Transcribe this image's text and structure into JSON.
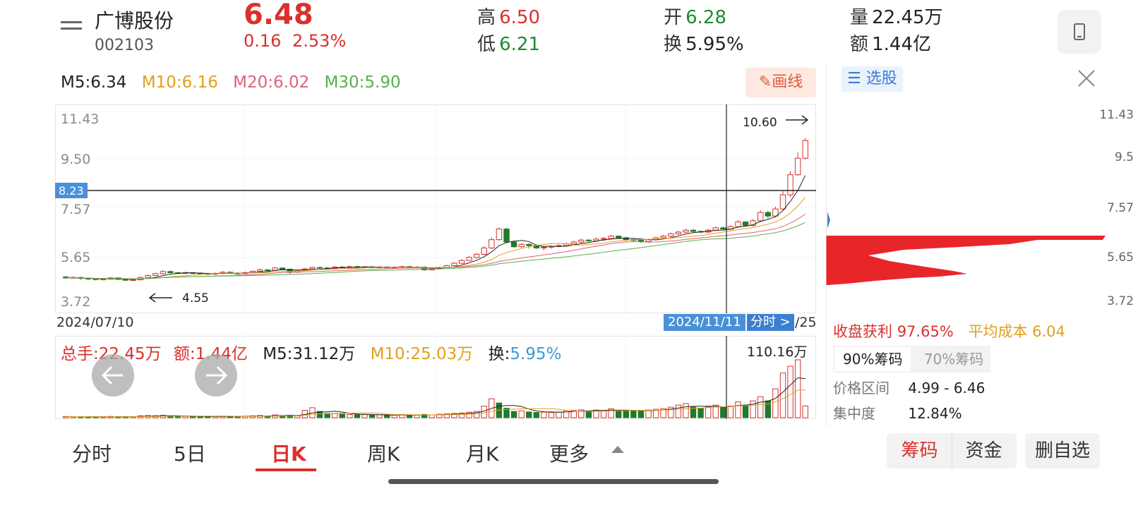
{
  "header": {
    "stock_name": "广博股份",
    "stock_code": "002103",
    "price": "6.48",
    "change": "0.16",
    "change_pct": "2.53%",
    "high_label": "高",
    "high": "6.50",
    "low_label": "低",
    "low": "6.21",
    "open_label": "开",
    "open": "6.28",
    "turnover_label": "换",
    "turnover": "5.95%",
    "volume_label": "量",
    "volume": "22.45万",
    "amount_label": "额",
    "amount": "1.44亿"
  },
  "ma_bar": {
    "m5": "M5:6.34",
    "m10": "M10:6.16",
    "m20": "M20:6.02",
    "m30": "M30:5.90",
    "draw_button": "画线"
  },
  "price_axis": [
    "11.43",
    "9.50",
    "7.57",
    "5.65",
    "3.72"
  ],
  "crosshair_price": "8.23",
  "max_marker": "10.60",
  "min_marker": "4.55",
  "date_start": "2024/07/10",
  "crosshair_date": "2024/11/11",
  "date_end_partial": "/25",
  "fenshi_button": "分时 >",
  "volume_bar": {
    "total": "总手:22.45万",
    "amount": "额:1.44亿",
    "m5": "M5:31.12万",
    "m10": "M10:25.03万",
    "turnover_label": "换:",
    "turnover": "5.95%",
    "max": "110.16万"
  },
  "chip_panel": {
    "select_label": "选股",
    "axis": [
      "11.43",
      "9.5",
      "7.57",
      "5.65",
      "3.72"
    ],
    "profit_label": "收盘获利",
    "profit": "97.65%",
    "avg_cost_label": "平均成本",
    "avg_cost": "6.04",
    "tab_90": "90%筹码",
    "tab_70": "70%筹码",
    "range_label": "价格区间",
    "range": "4.99 - 6.46",
    "concentration_label": "集中度",
    "concentration": "12.84%"
  },
  "bottom_tabs": [
    "分时",
    "5日",
    "日K",
    "周K",
    "月K",
    "更多"
  ],
  "bottom_buttons": [
    "筹码",
    "资金",
    "删自选"
  ],
  "colors": {
    "up": "#d9312c",
    "down": "#1f7a2a",
    "m5": "#222222",
    "m10": "#e0a020",
    "m20": "#e0607a",
    "m30": "#58b04e"
  },
  "chart_data": {
    "type": "candlestick",
    "ylim": [
      3.72,
      11.43
    ],
    "candles": [
      [
        4.72,
        4.68,
        4.76,
        4.63
      ],
      [
        4.68,
        4.7,
        4.75,
        4.64
      ],
      [
        4.7,
        4.66,
        4.73,
        4.6
      ],
      [
        4.66,
        4.64,
        4.7,
        4.59
      ],
      [
        4.64,
        4.61,
        4.68,
        4.57
      ],
      [
        4.61,
        4.63,
        4.67,
        4.58
      ],
      [
        4.63,
        4.68,
        4.72,
        4.6
      ],
      [
        4.68,
        4.62,
        4.7,
        4.58
      ],
      [
        4.62,
        4.58,
        4.65,
        4.55
      ],
      [
        4.58,
        4.6,
        4.64,
        4.55
      ],
      [
        4.6,
        4.7,
        4.74,
        4.58
      ],
      [
        4.7,
        4.78,
        4.82,
        4.68
      ],
      [
        4.78,
        4.86,
        4.9,
        4.75
      ],
      [
        4.86,
        4.95,
        5.0,
        4.83
      ],
      [
        4.95,
        4.9,
        4.99,
        4.86
      ],
      [
        4.9,
        4.87,
        4.94,
        4.84
      ],
      [
        4.87,
        4.9,
        4.95,
        4.84
      ],
      [
        4.9,
        4.88,
        4.93,
        4.85
      ],
      [
        4.88,
        4.86,
        4.92,
        4.82
      ],
      [
        4.86,
        4.84,
        4.9,
        4.8
      ],
      [
        4.84,
        4.87,
        4.92,
        4.8
      ],
      [
        4.87,
        4.92,
        4.97,
        4.84
      ],
      [
        4.92,
        4.88,
        4.96,
        4.85
      ],
      [
        4.88,
        4.86,
        4.92,
        4.82
      ],
      [
        4.86,
        4.9,
        4.95,
        4.84
      ],
      [
        4.9,
        4.96,
        5.0,
        4.87
      ],
      [
        4.96,
        5.02,
        5.08,
        4.93
      ],
      [
        5.02,
        5.0,
        5.06,
        4.97
      ],
      [
        5.0,
        5.1,
        5.14,
        4.98
      ],
      [
        5.1,
        5.05,
        5.12,
        5.0
      ],
      [
        5.05,
        4.92,
        5.07,
        4.85
      ],
      [
        4.92,
        5.0,
        5.04,
        4.9
      ],
      [
        5.0,
        5.06,
        5.1,
        4.97
      ],
      [
        5.06,
        5.12,
        5.16,
        5.03
      ],
      [
        5.12,
        5.1,
        5.16,
        5.06
      ],
      [
        5.1,
        5.08,
        5.14,
        5.04
      ],
      [
        5.08,
        5.14,
        5.18,
        5.05
      ],
      [
        5.14,
        5.12,
        5.18,
        5.08
      ],
      [
        5.12,
        5.16,
        5.2,
        5.09
      ],
      [
        5.16,
        5.13,
        5.2,
        5.09
      ],
      [
        5.13,
        5.15,
        5.19,
        5.1
      ],
      [
        5.15,
        5.12,
        5.18,
        5.08
      ],
      [
        5.12,
        5.14,
        5.18,
        5.09
      ],
      [
        5.14,
        5.11,
        5.17,
        5.07
      ],
      [
        5.11,
        5.13,
        5.17,
        5.08
      ],
      [
        5.13,
        5.16,
        5.2,
        5.1
      ],
      [
        5.16,
        5.12,
        5.19,
        5.08
      ],
      [
        5.12,
        5.14,
        5.18,
        5.09
      ],
      [
        5.14,
        5.02,
        5.16,
        4.98
      ],
      [
        5.02,
        5.08,
        5.12,
        5.0
      ],
      [
        5.08,
        5.12,
        5.16,
        5.05
      ],
      [
        5.12,
        5.2,
        5.24,
        5.1
      ],
      [
        5.2,
        5.3,
        5.35,
        5.17
      ],
      [
        5.3,
        5.42,
        5.48,
        5.28
      ],
      [
        5.42,
        5.55,
        5.6,
        5.4
      ],
      [
        5.55,
        5.68,
        5.74,
        5.5
      ],
      [
        5.68,
        5.95,
        6.02,
        5.64
      ],
      [
        5.95,
        6.3,
        6.4,
        5.9
      ],
      [
        6.3,
        6.75,
        6.82,
        6.25
      ],
      [
        6.75,
        6.2,
        6.8,
        6.15
      ],
      [
        6.2,
        6.0,
        6.25,
        5.95
      ],
      [
        6.0,
        6.1,
        6.16,
        5.95
      ],
      [
        6.1,
        6.05,
        6.15,
        5.92
      ],
      [
        6.05,
        5.95,
        6.1,
        5.9
      ],
      [
        5.95,
        5.98,
        6.02,
        5.85
      ],
      [
        5.98,
        6.02,
        6.06,
        5.92
      ],
      [
        6.02,
        6.05,
        6.1,
        5.98
      ],
      [
        6.05,
        6.12,
        6.18,
        6.0
      ],
      [
        6.12,
        6.2,
        6.26,
        6.08
      ],
      [
        6.2,
        6.28,
        6.34,
        6.15
      ],
      [
        6.28,
        6.25,
        6.32,
        6.2
      ],
      [
        6.25,
        6.32,
        6.38,
        6.2
      ],
      [
        6.32,
        6.35,
        6.42,
        6.26
      ],
      [
        6.35,
        6.45,
        6.5,
        6.3
      ],
      [
        6.45,
        6.38,
        6.48,
        6.32
      ],
      [
        6.38,
        6.3,
        6.42,
        6.26
      ],
      [
        6.3,
        6.28,
        6.36,
        6.22
      ],
      [
        6.28,
        6.22,
        6.32,
        6.16
      ],
      [
        6.22,
        6.3,
        6.35,
        6.18
      ],
      [
        6.3,
        6.38,
        6.42,
        6.26
      ],
      [
        6.38,
        6.45,
        6.5,
        6.34
      ],
      [
        6.45,
        6.55,
        6.6,
        6.4
      ],
      [
        6.55,
        6.62,
        6.68,
        6.5
      ],
      [
        6.62,
        6.7,
        6.76,
        6.58
      ],
      [
        6.7,
        6.65,
        6.75,
        6.6
      ],
      [
        6.65,
        6.62,
        6.7,
        6.58
      ],
      [
        6.62,
        6.7,
        6.76,
        6.58
      ],
      [
        6.7,
        6.8,
        6.86,
        6.66
      ],
      [
        6.8,
        6.75,
        6.85,
        6.7
      ],
      [
        6.75,
        6.85,
        6.92,
        6.7
      ],
      [
        6.85,
        7.05,
        7.12,
        6.82
      ],
      [
        7.05,
        6.9,
        7.08,
        6.85
      ],
      [
        6.9,
        7.1,
        7.18,
        6.86
      ],
      [
        7.1,
        7.45,
        7.55,
        7.05
      ],
      [
        7.45,
        7.3,
        7.52,
        7.2
      ],
      [
        7.3,
        7.6,
        7.7,
        7.25
      ],
      [
        7.6,
        8.2,
        8.35,
        7.55
      ],
      [
        8.2,
        9.05,
        9.2,
        8.1
      ],
      [
        9.05,
        9.75,
        10.0,
        9.0
      ],
      [
        9.75,
        10.5,
        10.6,
        9.7
      ]
    ],
    "volumes": [
      [
        2.1,
        1
      ],
      [
        1.8,
        1
      ],
      [
        2.0,
        0
      ],
      [
        1.5,
        0
      ],
      [
        1.7,
        0
      ],
      [
        1.6,
        1
      ],
      [
        2.4,
        1
      ],
      [
        1.9,
        0
      ],
      [
        2.2,
        0
      ],
      [
        1.8,
        1
      ],
      [
        3.6,
        1
      ],
      [
        4.2,
        1
      ],
      [
        3.8,
        1
      ],
      [
        4.6,
        1
      ],
      [
        3.0,
        0
      ],
      [
        2.6,
        0
      ],
      [
        2.8,
        1
      ],
      [
        2.4,
        0
      ],
      [
        2.2,
        0
      ],
      [
        2.0,
        0
      ],
      [
        2.6,
        1
      ],
      [
        3.0,
        1
      ],
      [
        2.4,
        0
      ],
      [
        2.2,
        0
      ],
      [
        2.9,
        1
      ],
      [
        3.6,
        1
      ],
      [
        4.4,
        1
      ],
      [
        3.0,
        0
      ],
      [
        5.2,
        1
      ],
      [
        4.0,
        0
      ],
      [
        4.6,
        0
      ],
      [
        3.4,
        1
      ],
      [
        14.0,
        1
      ],
      [
        19.0,
        1
      ],
      [
        12.0,
        0
      ],
      [
        8.2,
        0
      ],
      [
        7.6,
        1
      ],
      [
        6.8,
        0
      ],
      [
        6.2,
        1
      ],
      [
        5.6,
        0
      ],
      [
        5.8,
        1
      ],
      [
        5.2,
        0
      ],
      [
        5.4,
        1
      ],
      [
        4.8,
        0
      ],
      [
        5.0,
        1
      ],
      [
        6.0,
        1
      ],
      [
        5.0,
        0
      ],
      [
        4.8,
        1
      ],
      [
        6.2,
        0
      ],
      [
        5.2,
        1
      ],
      [
        6.6,
        1
      ],
      [
        7.2,
        1
      ],
      [
        8.0,
        1
      ],
      [
        9.0,
        1
      ],
      [
        10.5,
        1
      ],
      [
        12.0,
        1
      ],
      [
        22.0,
        1
      ],
      [
        36.0,
        1
      ],
      [
        28.0,
        0
      ],
      [
        18.0,
        0
      ],
      [
        12.0,
        0
      ],
      [
        13.0,
        1
      ],
      [
        11.0,
        0
      ],
      [
        10.0,
        0
      ],
      [
        10.6,
        1
      ],
      [
        9.8,
        1
      ],
      [
        10.8,
        1
      ],
      [
        13.0,
        1
      ],
      [
        14.0,
        1
      ],
      [
        15.0,
        1
      ],
      [
        12.0,
        0
      ],
      [
        14.5,
        1
      ],
      [
        13.4,
        1
      ],
      [
        17.0,
        1
      ],
      [
        14.0,
        0
      ],
      [
        13.0,
        0
      ],
      [
        12.6,
        0
      ],
      [
        13.2,
        0
      ],
      [
        14.6,
        1
      ],
      [
        16.0,
        1
      ],
      [
        17.4,
        1
      ],
      [
        20.0,
        1
      ],
      [
        24.0,
        1
      ],
      [
        27.0,
        1
      ],
      [
        20.0,
        0
      ],
      [
        18.0,
        0
      ],
      [
        20.5,
        1
      ],
      [
        24.0,
        1
      ],
      [
        20.0,
        0
      ],
      [
        22.0,
        1
      ],
      [
        30.0,
        1
      ],
      [
        24.0,
        0
      ],
      [
        32.0,
        1
      ],
      [
        40.0,
        1
      ],
      [
        32.0,
        0
      ],
      [
        55.0,
        1
      ],
      [
        85.0,
        1
      ],
      [
        98.0,
        1
      ],
      [
        110.16,
        1
      ],
      [
        22.45,
        1
      ]
    ]
  }
}
